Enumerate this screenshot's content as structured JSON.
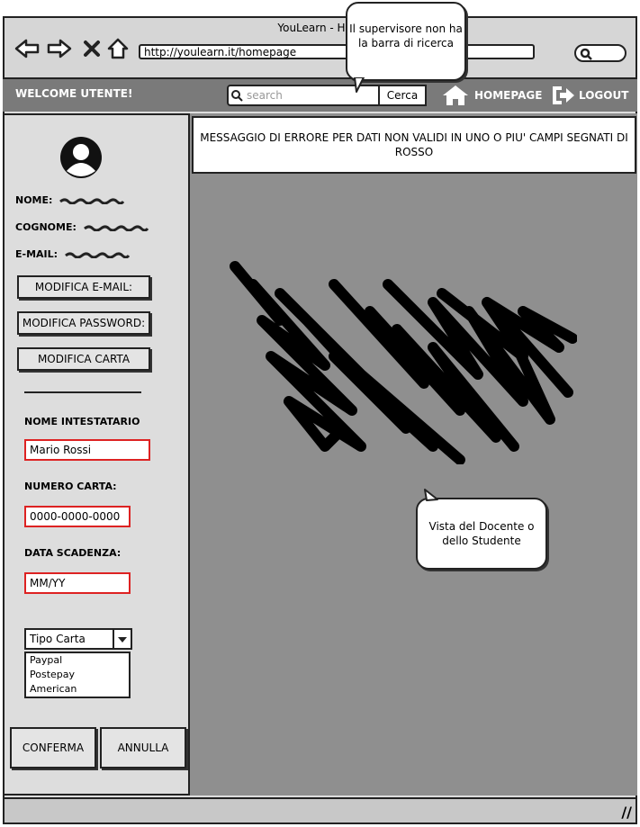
{
  "browser": {
    "title": "YouLearn - Hom",
    "url": "http://youlearn.it/homepage"
  },
  "header": {
    "welcome": "WELCOME UTENTE!",
    "search_placeholder": "search",
    "search_button": "Cerca",
    "homepage": "HOMEPAGE",
    "logout": "LOGOUT"
  },
  "sidebar": {
    "nome_label": "NOME:",
    "cognome_label": "COGNOME:",
    "email_label": "E-MAIL:",
    "btn_email": "MODIFICA E-MAIL:",
    "btn_password": "MODIFICA PASSWORD:",
    "btn_carta": "MODIFICA CARTA",
    "intestatario_label": "NOME INTESTATARIO",
    "intestatario_value": "Mario Rossi",
    "numero_label": "NUMERO CARTA:",
    "numero_value": "0000-0000-0000",
    "scadenza_label": "DATA SCADENZA:",
    "scadenza_value": "MM/YY",
    "tipo_label": "Tipo Carta",
    "tipo_options": [
      "Paypal",
      "Postepay",
      "American"
    ],
    "conferma": "CONFERMA",
    "annulla": "ANNULLA"
  },
  "main": {
    "error_message": "MESSAGGIO DI ERRORE PER DATI NON VALIDI IN UNO O PIU' CAMPI SEGNATI DI ROSSO"
  },
  "notes": {
    "supervisor": "Il supervisore non ha la barra di ricerca",
    "view": "Vista del Docente o dello Studente"
  },
  "colors": {
    "header_bg": "#7a7a7a",
    "main_bg": "#8f8f8f",
    "error_border": "#dd2222"
  }
}
